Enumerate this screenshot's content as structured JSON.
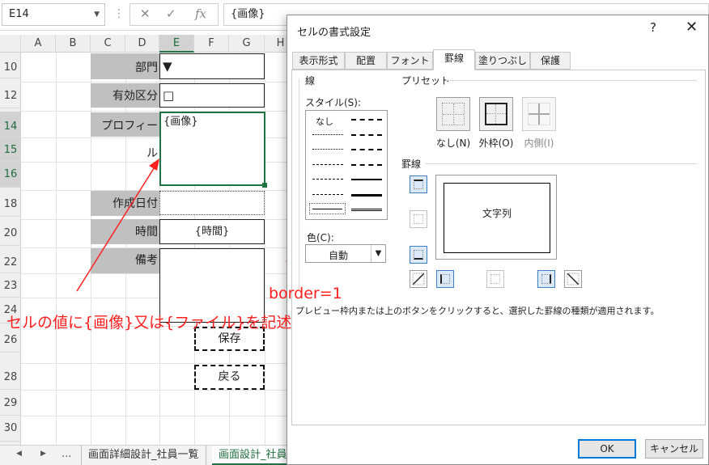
{
  "formula_bar": {
    "name_box": "E14",
    "content": "{画像}"
  },
  "columns": [
    "A",
    "B",
    "C",
    "D",
    "E",
    "F",
    "G",
    "H"
  ],
  "rows": [
    "10",
    "12",
    "14",
    "15",
    "16",
    "18",
    "20",
    "22",
    "23",
    "24",
    "26",
    "28",
    "29",
    "30"
  ],
  "cells": {
    "label_bumon": "部門",
    "label_yuko": "有効区分",
    "label_profile": "プロフィール",
    "label_sakusei": "作成日付",
    "label_jikan": "時間",
    "label_biko": "備考",
    "val_bumon": "▼",
    "val_yuko": "□",
    "val_profile": "{画像}",
    "val_jikan": "{時間}",
    "btn_hozon": "保存",
    "btn_modoru": "戻る"
  },
  "sheet_tabs": {
    "more": "...",
    "tab1": "画面詳細設計_社員一覧",
    "tab2": "画面設計_社員"
  },
  "annotations": {
    "main": "セルの値に{画像}又は{ファイル}を記述",
    "border": "border=1"
  },
  "dialog": {
    "title": "セルの書式設定",
    "help": "?",
    "close": "✕",
    "tabs": [
      "表示形式",
      "配置",
      "フォント",
      "罫線",
      "塗りつぶし",
      "保護"
    ],
    "line_group": "線",
    "style_label": "スタイル(S):",
    "style_none": "なし",
    "color_label": "色(C):",
    "color_value": "自動",
    "preset_group": "プリセット",
    "preset_none": "なし(N)",
    "preset_outline": "外枠(O)",
    "preset_inside": "内側(I)",
    "border_group": "罫線",
    "preview_text": "文字列",
    "hint": "プレビュー枠内または上のボタンをクリックすると、選択した罫線の種類が適用されます。",
    "ok": "OK",
    "cancel": "キャンセル"
  }
}
